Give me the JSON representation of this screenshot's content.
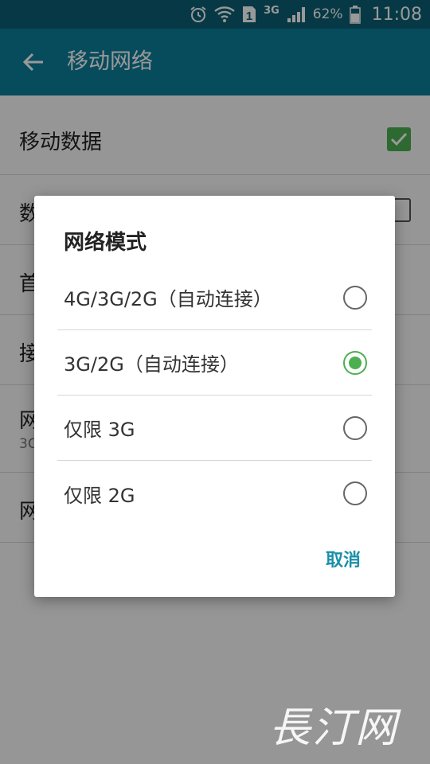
{
  "status_bar": {
    "network": "3G",
    "sim_slot": "1",
    "battery_percent": "62%",
    "time": "11:08",
    "icons": [
      "alarm-icon",
      "wifi-icon",
      "sim-icon",
      "signal-icon",
      "battery-icon"
    ]
  },
  "app_bar": {
    "title": "移动网络",
    "back_icon": "arrow-back-icon"
  },
  "settings": {
    "rows": [
      {
        "title": "移动数据",
        "checked": true
      },
      {
        "title": "数"
      },
      {
        "title": "首"
      },
      {
        "title": "接"
      },
      {
        "title": "网",
        "subtitle": "3C"
      },
      {
        "title": "网"
      }
    ]
  },
  "dialog": {
    "title": "网络模式",
    "options": [
      {
        "label": "4G/3G/2G（自动连接）",
        "selected": false
      },
      {
        "label": "3G/2G（自动连接）",
        "selected": true
      },
      {
        "label": "仅限 3G",
        "selected": false
      },
      {
        "label": "仅限 2G",
        "selected": false
      }
    ],
    "cancel_label": "取消"
  },
  "watermark": "長汀网",
  "colors": {
    "status_bar": "#0b5f73",
    "app_bar": "#0d7f99",
    "accent_green": "#4caf50",
    "button_teal": "#1a8fa8"
  }
}
